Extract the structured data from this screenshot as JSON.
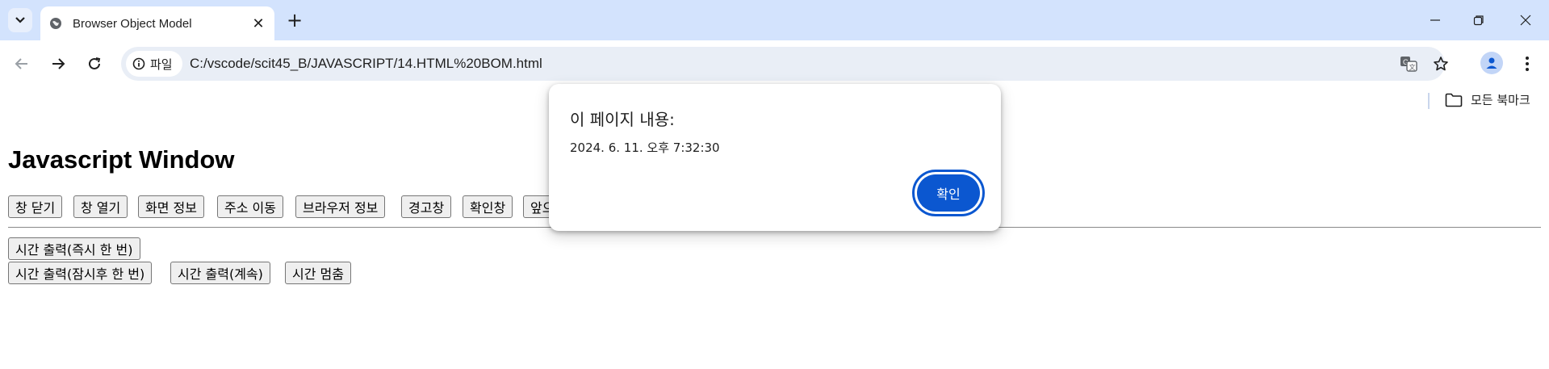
{
  "browser": {
    "tab_title": "Browser Object Model",
    "url": "C:/vscode/scit45_B/JAVASCRIPT/14.HTML%20BOM.html",
    "info_chip_label": "파일",
    "bookmarks_all_label": "모든 북마크",
    "accent_color": "#0b57d0",
    "tabstrip_color": "#d3e3fd"
  },
  "page": {
    "heading": "Javascript Window",
    "buttons_row1": [
      "창 닫기",
      "창 열기",
      "화면 정보",
      "주소 이동",
      "브라우저 정보",
      "경고창",
      "확인창",
      "앞으"
    ],
    "buttons_row2": [
      "시간 출력(즉시 한 번)"
    ],
    "buttons_row3": [
      "시간 출력(잠시후 한 번)",
      "시간 출력(계속)",
      "시간 멈춤"
    ]
  },
  "dialog": {
    "title": "이 페이지 내용:",
    "message": "2024. 6. 11. 오후 7:32:30",
    "ok_label": "확인"
  },
  "icons": [
    "chevron-down-icon",
    "globe-icon",
    "close-icon",
    "plus-icon",
    "minimize-icon",
    "restore-icon",
    "window-close-icon",
    "back-arrow-icon",
    "forward-arrow-icon",
    "reload-icon",
    "info-icon",
    "translate-icon",
    "star-icon",
    "profile-icon",
    "more-vert-icon",
    "folder-icon"
  ]
}
